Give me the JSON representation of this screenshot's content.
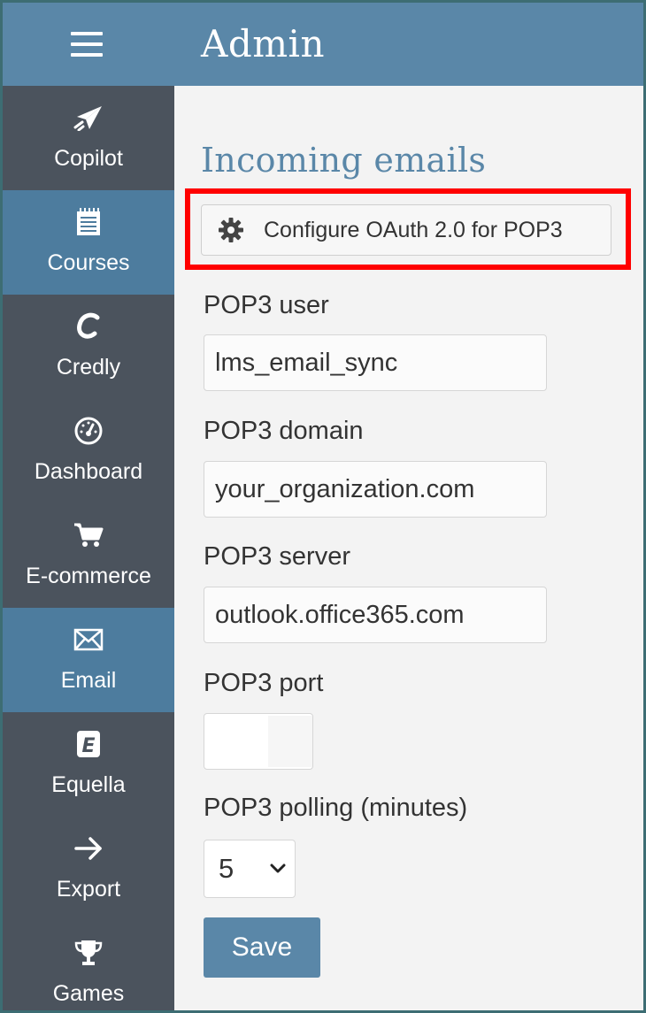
{
  "header": {
    "title": "Admin",
    "menu_icon": "hamburger-menu-icon",
    "background_color": "#5a87a8"
  },
  "sidebar": {
    "background_color": "#4b535d",
    "active_color": "#4d7c9e",
    "items": [
      {
        "label": "Copilot",
        "icon": "paper-plane-icon",
        "active": false
      },
      {
        "label": "Courses",
        "icon": "notebook-icon",
        "active": true
      },
      {
        "label": "Credly",
        "icon": "credly-logo-icon",
        "active": false
      },
      {
        "label": "Dashboard",
        "icon": "speedometer-icon",
        "active": false
      },
      {
        "label": "E-commerce",
        "icon": "shopping-cart-icon",
        "active": false
      },
      {
        "label": "Email",
        "icon": "envelope-icon",
        "active": true
      },
      {
        "label": "Equella",
        "icon": "equella-logo-icon",
        "active": false
      },
      {
        "label": "Export",
        "icon": "arrow-right-icon",
        "active": false
      },
      {
        "label": "Games",
        "icon": "trophy-icon",
        "active": false
      }
    ]
  },
  "main": {
    "section_title": "Incoming emails",
    "oauth_button": {
      "label": "Configure OAuth 2.0 for POP3",
      "icon": "gear-icon"
    },
    "highlight_color": "#ff0000",
    "fields": {
      "pop3_user": {
        "label": "POP3 user",
        "value": "lms_email_sync"
      },
      "pop3_domain": {
        "label": "POP3 domain",
        "value": "your_organization.com"
      },
      "pop3_server": {
        "label": "POP3 server",
        "value": "outlook.office365.com"
      },
      "pop3_port": {
        "label": "POP3 port",
        "value": ""
      },
      "pop3_polling": {
        "label": "POP3 polling (minutes)",
        "value": "5"
      }
    },
    "save_label": "Save"
  }
}
